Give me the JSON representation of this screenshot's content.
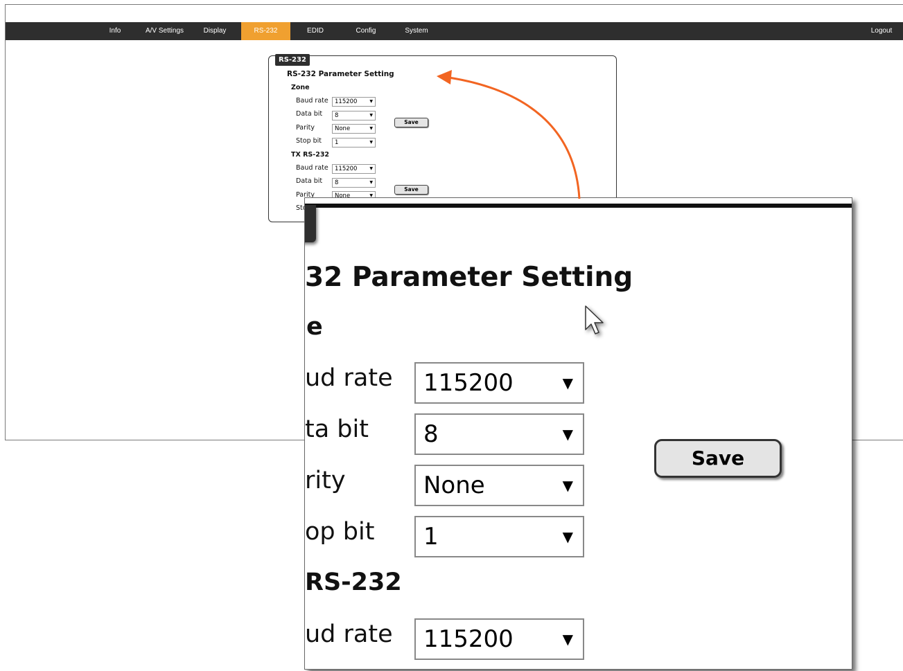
{
  "nav": {
    "items": [
      "Info",
      "A/V Settings",
      "Display",
      "RS-232",
      "EDID",
      "Config",
      "System"
    ],
    "active": "RS-232",
    "logout": "Logout"
  },
  "panel": {
    "tab": "RS-232",
    "title": "RS-232 Parameter Setting",
    "zone": {
      "heading": "Zone",
      "baud_label": "Baud rate",
      "baud_value": "115200",
      "data_label": "Data bit",
      "data_value": "8",
      "parity_label": "Parity",
      "parity_value": "None",
      "stop_label": "Stop bit",
      "stop_value": "1",
      "save": "Save"
    },
    "tx": {
      "heading": "TX RS-232",
      "baud_label": "Baud rate",
      "baud_value": "115200",
      "data_label": "Data bit",
      "data_value": "8",
      "parity_label": "Parity",
      "parity_value": "None",
      "stop_label_partial": "Sto",
      "save": "Save"
    }
  },
  "zoom": {
    "title_partial": "32 Parameter Setting",
    "zone_partial": "e",
    "baud_partial": "ud rate",
    "baud_value": "115200",
    "data_partial": "ta bit",
    "data_value": "8",
    "parity_partial": "rity",
    "parity_value": "None",
    "stop_partial": "op bit",
    "stop_value": "1",
    "tx_partial": "RS-232",
    "baud2_partial": "ud rate",
    "baud2_value": "115200",
    "save": "Save"
  },
  "dropdown_arrow": "▼",
  "accent_color": "#f0a030",
  "callout_arrow_color": "#f26522"
}
